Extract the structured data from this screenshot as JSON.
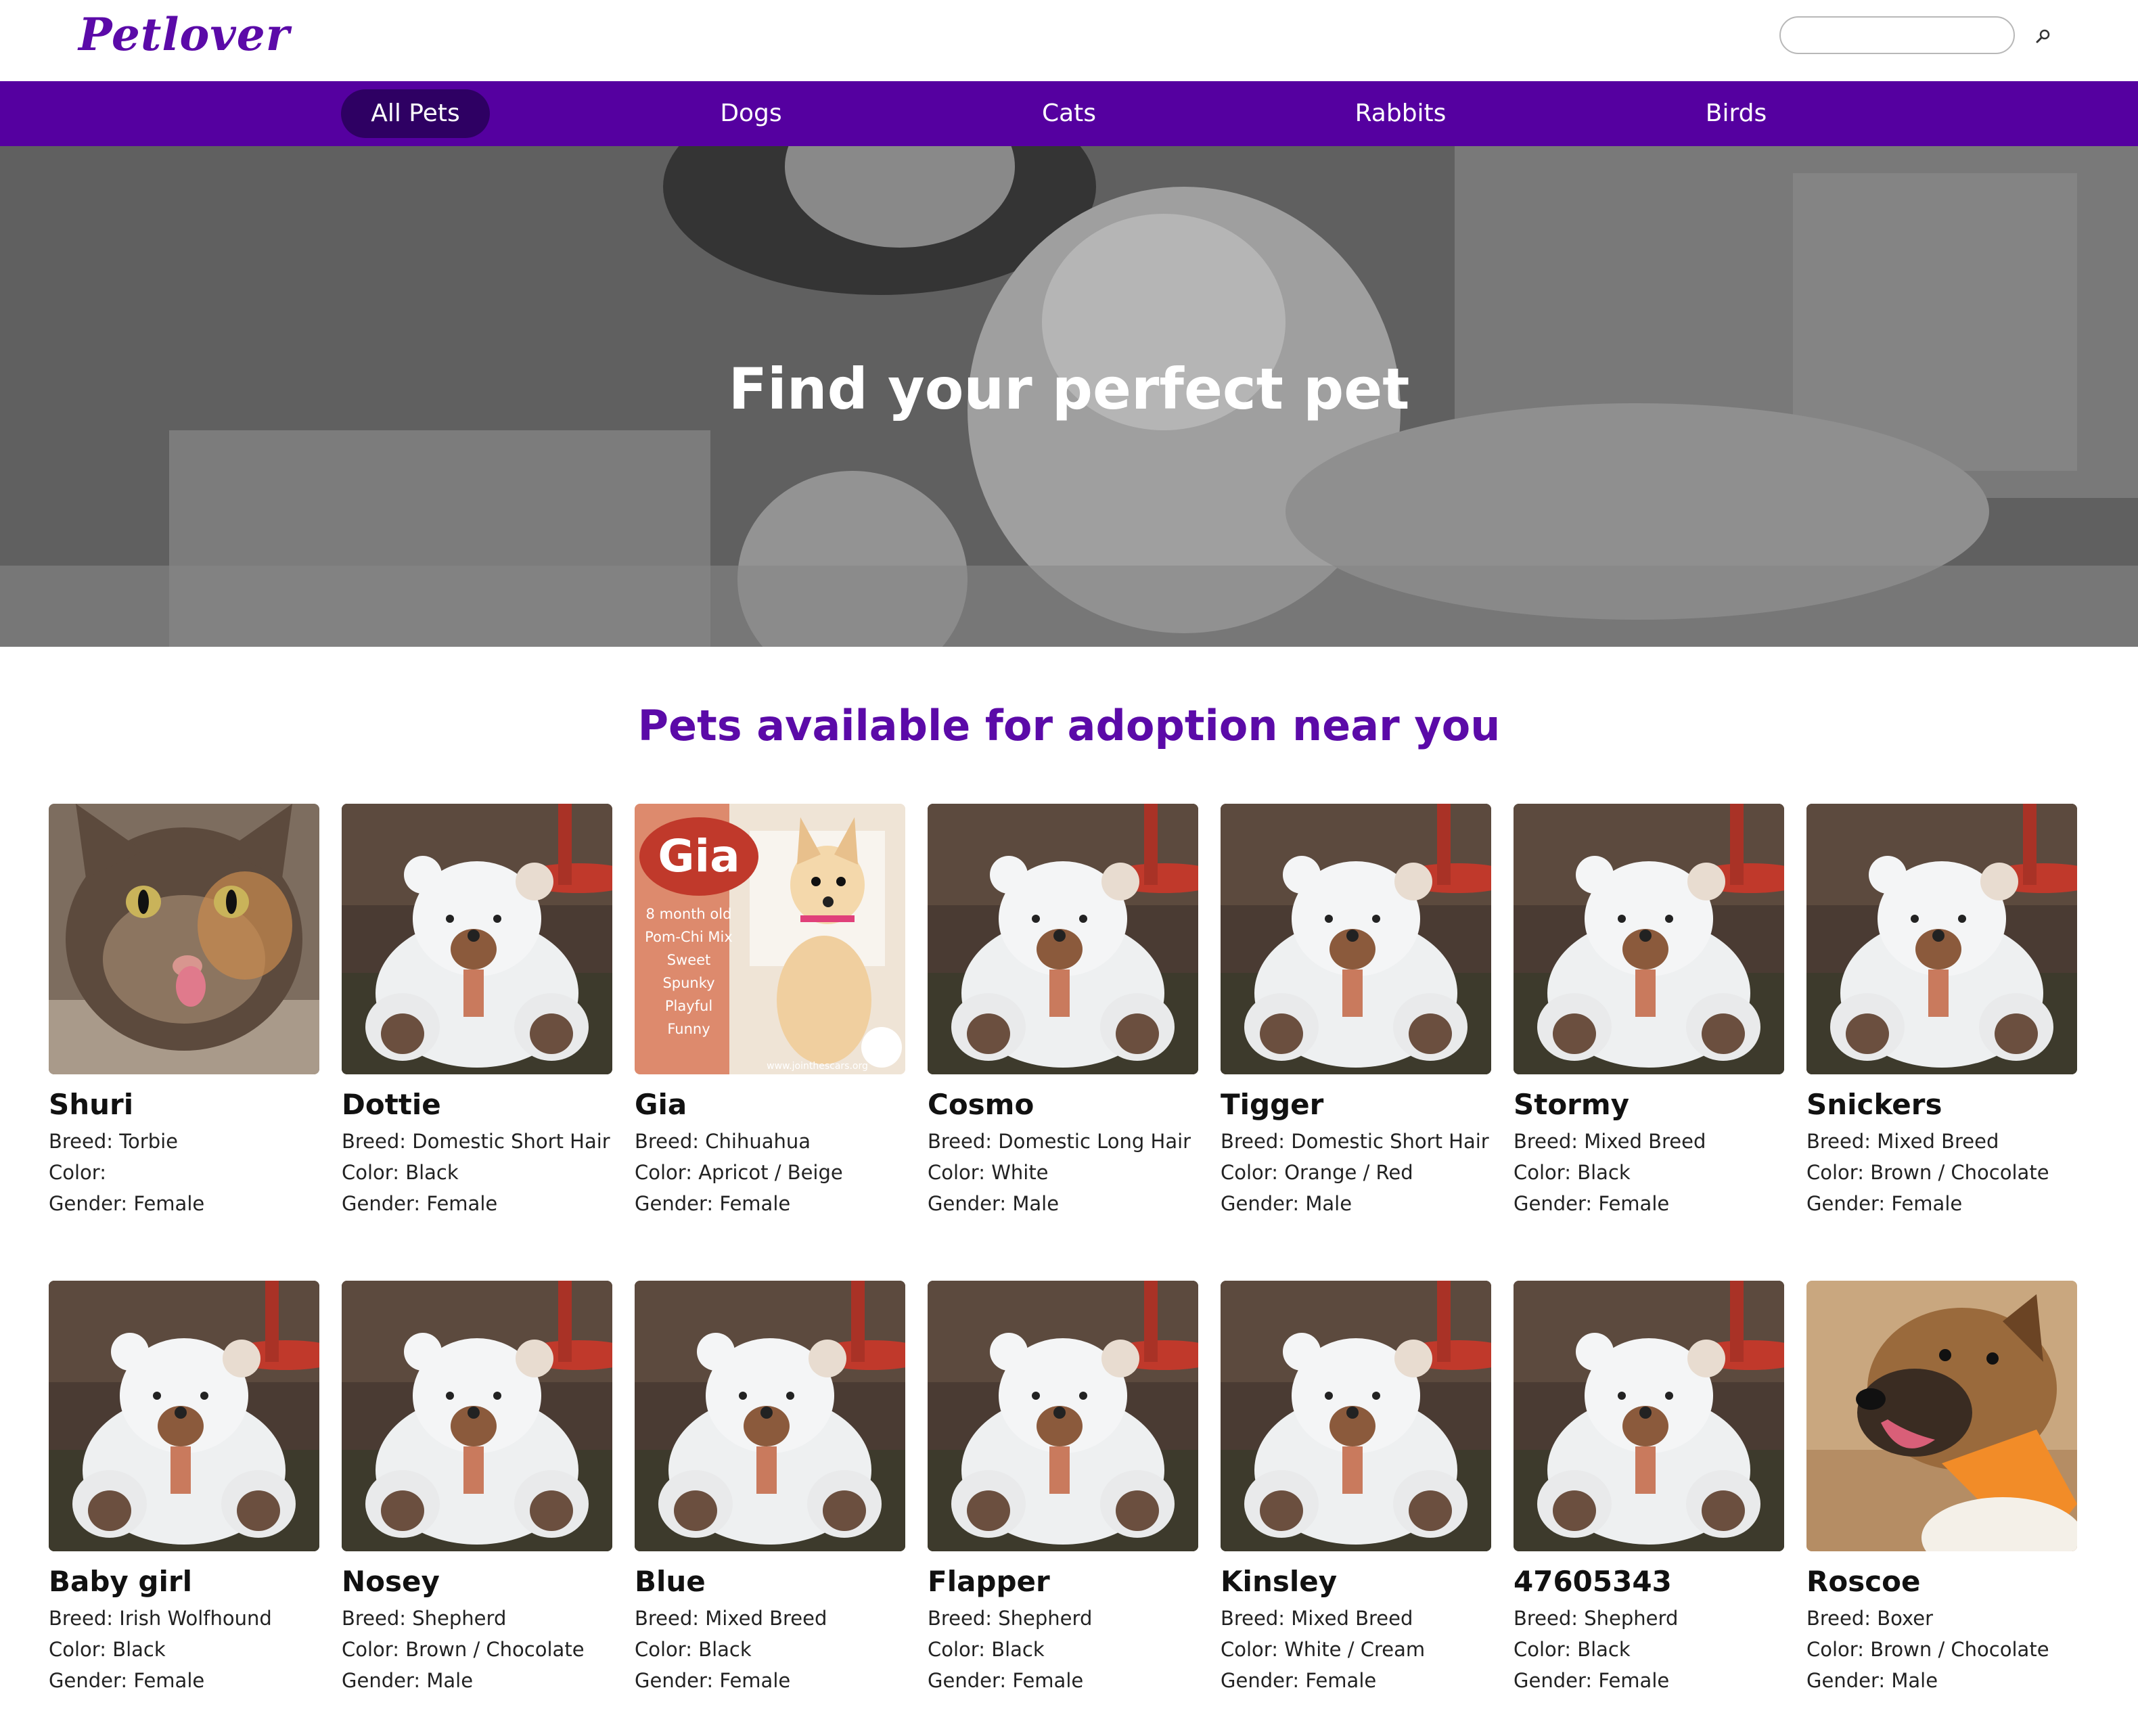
{
  "header": {
    "logo": "Petlover",
    "search": {
      "value": "",
      "placeholder": ""
    }
  },
  "nav": {
    "items": [
      {
        "label": "All Pets",
        "active": true
      },
      {
        "label": "Dogs"
      },
      {
        "label": "Cats"
      },
      {
        "label": "Rabbits"
      },
      {
        "label": "Birds"
      }
    ]
  },
  "hero": {
    "title": "Find your perfect pet"
  },
  "section": {
    "title": "Pets available for adoption near you"
  },
  "labels": {
    "breed": "Breed:",
    "color": "Color:",
    "gender": "Gender:"
  },
  "gia_poster": {
    "name": "Gia",
    "lines": [
      "8 month old",
      "Pom-Chi Mix",
      "Sweet",
      "Spunky",
      "Playful",
      "Funny"
    ],
    "url": "www.jointhescars.org"
  },
  "pets": [
    {
      "name": "Shuri",
      "breed": "Torbie",
      "color": "",
      "gender": "Female",
      "photo": "cat"
    },
    {
      "name": "Dottie",
      "breed": "Domestic Short Hair",
      "color": "Black",
      "gender": "Female",
      "photo": "teddy"
    },
    {
      "name": "Gia",
      "breed": "Chihuahua",
      "color": "Apricot / Beige",
      "gender": "Female",
      "photo": "gia"
    },
    {
      "name": "Cosmo",
      "breed": "Domestic Long Hair",
      "color": "White",
      "gender": "Male",
      "photo": "teddy"
    },
    {
      "name": "Tigger",
      "breed": "Domestic Short Hair",
      "color": "Orange / Red",
      "gender": "Male",
      "photo": "teddy"
    },
    {
      "name": "Stormy",
      "breed": "Mixed Breed",
      "color": "Black",
      "gender": "Female",
      "photo": "teddy"
    },
    {
      "name": "Snickers",
      "breed": "Mixed Breed",
      "color": "Brown / Chocolate",
      "gender": "Female",
      "photo": "teddy"
    },
    {
      "name": "Baby girl",
      "breed": "Irish Wolfhound",
      "color": "Black",
      "gender": "Female",
      "photo": "teddy"
    },
    {
      "name": "Nosey",
      "breed": "Shepherd",
      "color": "Brown / Chocolate",
      "gender": "Male",
      "photo": "teddy"
    },
    {
      "name": "Blue",
      "breed": "Mixed Breed",
      "color": "Black",
      "gender": "Female",
      "photo": "teddy"
    },
    {
      "name": "Flapper",
      "breed": "Shepherd",
      "color": "Black",
      "gender": "Female",
      "photo": "teddy"
    },
    {
      "name": "Kinsley",
      "breed": "Mixed Breed",
      "color": "White / Cream",
      "gender": "Female",
      "photo": "teddy"
    },
    {
      "name": "47605343",
      "breed": "Shepherd",
      "color": "Black",
      "gender": "Female",
      "photo": "teddy"
    },
    {
      "name": "Roscoe",
      "breed": "Boxer",
      "color": "Brown / Chocolate",
      "gender": "Male",
      "photo": "dog"
    }
  ]
}
